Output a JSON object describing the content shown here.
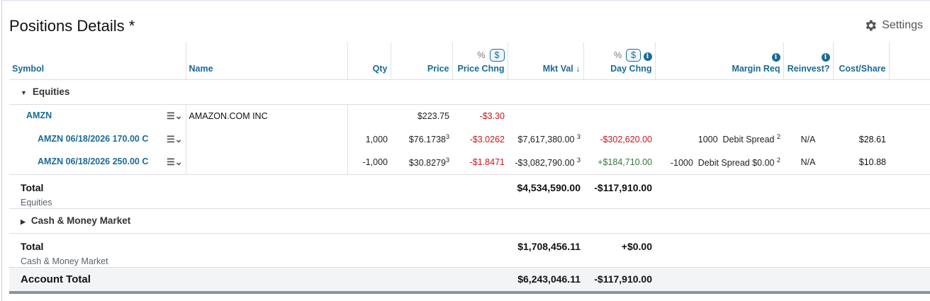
{
  "title": "Positions Details *",
  "settings_label": "Settings",
  "headers": {
    "symbol": "Symbol",
    "name": "Name",
    "qty": "Qty",
    "price": "Price",
    "price_chng": "Price Chng",
    "mkt_val": "Mkt Val",
    "sort_arrow": "↓",
    "day_chng": "Day Chng",
    "margin_req": "Margin Req",
    "reinvest": "Reinvest?",
    "cost_share": "Cost/Share",
    "pct": "%",
    "dollar": "$"
  },
  "groups": {
    "equities": "Equities",
    "cash": "Cash & Money Market"
  },
  "rows": [
    {
      "symbol": "AMZN",
      "name": "AMAZON.COM INC",
      "price": "$223.75",
      "price_chng": "-$3.30"
    },
    {
      "symbol": "AMZN 06/18/2026 170.00 C",
      "qty": "1,000",
      "price": "$76.1738",
      "price_sup": "3",
      "price_chng": "-$3.0262",
      "mkt_val": "$7,617,380.00",
      "mkt_sup": "3",
      "day_chng": "-$302,620.00",
      "margin": "1000  Debit Spread",
      "margin_sup": "2",
      "reinvest": "N/A",
      "cost": "$28.61"
    },
    {
      "symbol": "AMZN 06/18/2026 250.00 C",
      "qty": "-1,000",
      "price": "$30.8279",
      "price_sup": "3",
      "price_chng": "-$1.8471",
      "mkt_val": "-$3,082,790.00",
      "mkt_sup": "3",
      "day_chng": "+$184,710.00",
      "margin": "-1000  Debit Spread $0.00",
      "margin_sup": "2",
      "reinvest": "N/A",
      "cost": "$10.88"
    }
  ],
  "totals": {
    "equities": {
      "label": "Total",
      "sub": "Equities",
      "mkt_val": "$4,534,590.00",
      "day_chng": "-$117,910.00"
    },
    "cash": {
      "label": "Total",
      "sub": "Cash & Money Market",
      "mkt_val": "$1,708,456.11",
      "day_chng": "+$0.00"
    },
    "account": {
      "label": "Account Total",
      "mkt_val": "$6,243,046.11",
      "day_chng": "-$117,910.00"
    }
  }
}
